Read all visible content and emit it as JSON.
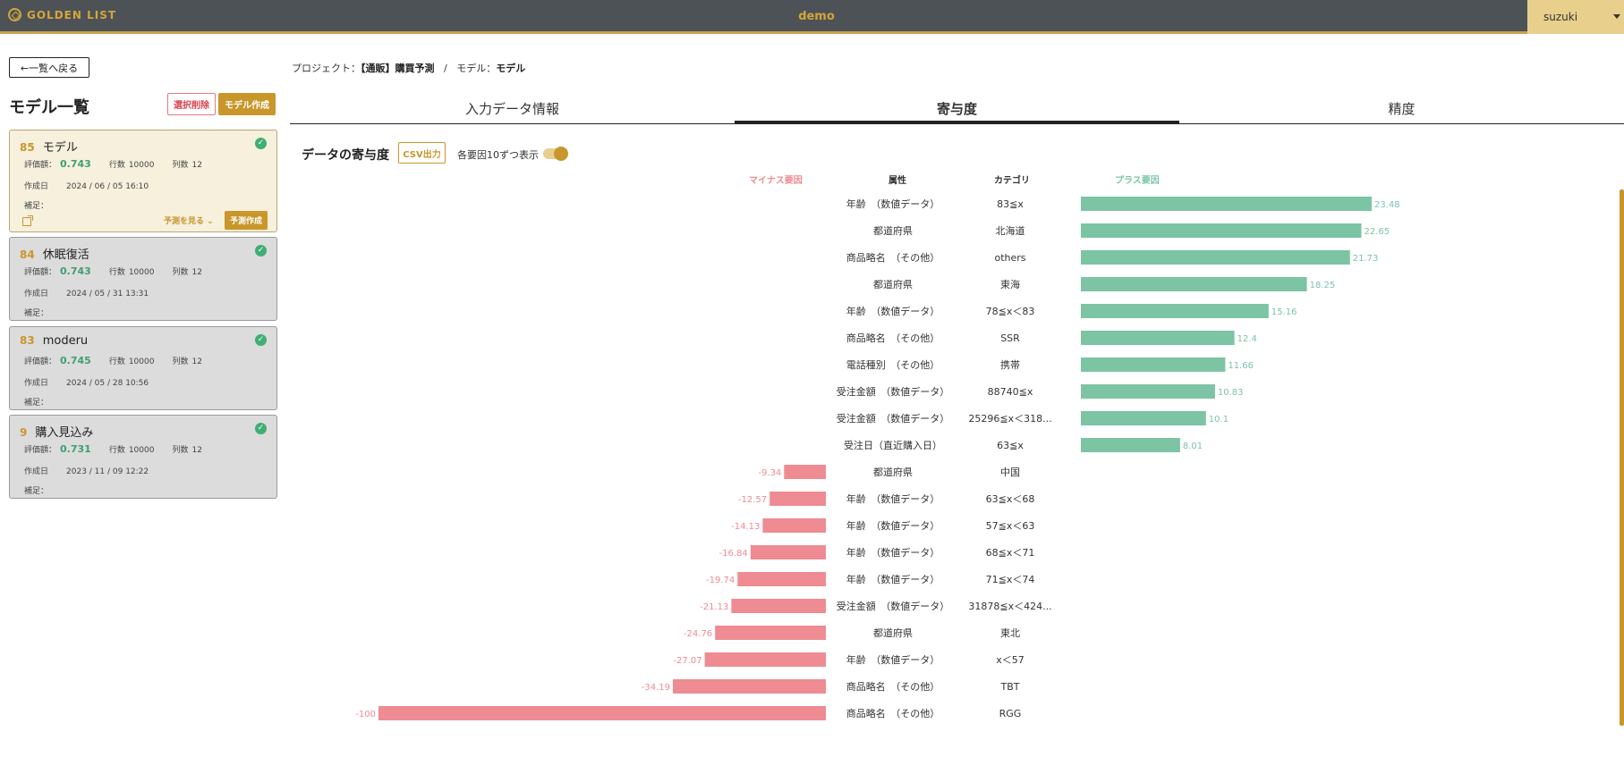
{
  "header": {
    "logo_text": "GOLDEN LIST",
    "project_title": "demo",
    "user": "suzuki"
  },
  "sidebar": {
    "back_label": "←一覧へ戻る",
    "title": "モデル一覧",
    "delete_label": "選択削除",
    "create_label": "モデル作成",
    "labels": {
      "score": "評価額：",
      "rows": "行数",
      "cols": "列数",
      "created": "作成日",
      "note": "補足："
    },
    "models": [
      {
        "id": "85",
        "name": "モデル",
        "score": "0.743",
        "rows": "10000",
        "cols": "12",
        "created": "2024 / 06 / 05 16:10",
        "active": true,
        "view_label": "予測を見る",
        "predict_label": "予測作成"
      },
      {
        "id": "84",
        "name": "休眠復活",
        "score": "0.743",
        "rows": "10000",
        "cols": "12",
        "created": "2024 / 05 / 31 13:31"
      },
      {
        "id": "83",
        "name": "moderu",
        "score": "0.745",
        "rows": "10000",
        "cols": "12",
        "created": "2024 / 05 / 28 10:56"
      },
      {
        "id": "9",
        "name": "購入見込み",
        "score": "0.731",
        "rows": "10000",
        "cols": "12",
        "created": "2023 / 11 / 09 12:22"
      }
    ]
  },
  "breadcrumb": {
    "project_label": "プロジェクト：",
    "project_name": "【通販】購買予測",
    "sep": "/",
    "model_label": "モデル：",
    "model_name": "モデル"
  },
  "tabs": [
    "入力データ情報",
    "寄与度",
    "精度"
  ],
  "contribution": {
    "title": "データの寄与度",
    "csv_label": "CSV出力",
    "toggle_label": "各要因10ずつ表示",
    "headers": {
      "minus": "マイナス要因",
      "attribute": "属性",
      "category": "カテゴリ",
      "plus": "プラス要因"
    }
  },
  "colors": {
    "positive": "#7cc4a4",
    "negative": "#ee8b93",
    "accent": "#c9962b"
  },
  "chart_data": {
    "type": "bar",
    "orientation": "horizontal",
    "rows": [
      {
        "attribute": "年齢　（数値データ）",
        "category": "83≦x",
        "value": 23.48
      },
      {
        "attribute": "都道府県",
        "category": "北海道",
        "value": 22.65
      },
      {
        "attribute": "商品略名　（その他）",
        "category": "others",
        "value": 21.73
      },
      {
        "attribute": "都道府県",
        "category": "東海",
        "value": 18.25
      },
      {
        "attribute": "年齢　（数値データ）",
        "category": "78≦x＜83",
        "value": 15.16
      },
      {
        "attribute": "商品略名　（その他）",
        "category": "SSR",
        "value": 12.4
      },
      {
        "attribute": "電話種別　（その他）",
        "category": "携帯",
        "value": 11.66
      },
      {
        "attribute": "受注金額　（数値データ）",
        "category": "88740≦x",
        "value": 10.83
      },
      {
        "attribute": "受注金額　（数値データ）",
        "category": "25296≦x＜318...",
        "value": 10.1
      },
      {
        "attribute": "受注日（直近購入日）",
        "category": "63≦x",
        "value": 8.01
      },
      {
        "attribute": "都道府県",
        "category": "中国",
        "value": -9.34
      },
      {
        "attribute": "年齢　（数値データ）",
        "category": "63≦x＜68",
        "value": -12.57
      },
      {
        "attribute": "年齢　（数値データ）",
        "category": "57≦x＜63",
        "value": -14.13
      },
      {
        "attribute": "年齢　（数値データ）",
        "category": "68≦x＜71",
        "value": -16.84
      },
      {
        "attribute": "年齢　（数値データ）",
        "category": "71≦x＜74",
        "value": -19.74
      },
      {
        "attribute": "受注金額　（数値データ）",
        "category": "31878≦x＜424...",
        "value": -21.13
      },
      {
        "attribute": "都道府県",
        "category": "東北",
        "value": -24.76
      },
      {
        "attribute": "年齢　（数値データ）",
        "category": "x＜57",
        "value": -27.07
      },
      {
        "attribute": "商品略名　（その他）",
        "category": "TBT",
        "value": -34.19
      },
      {
        "attribute": "商品略名　（その他）",
        "category": "RGG",
        "value": -100
      }
    ]
  }
}
